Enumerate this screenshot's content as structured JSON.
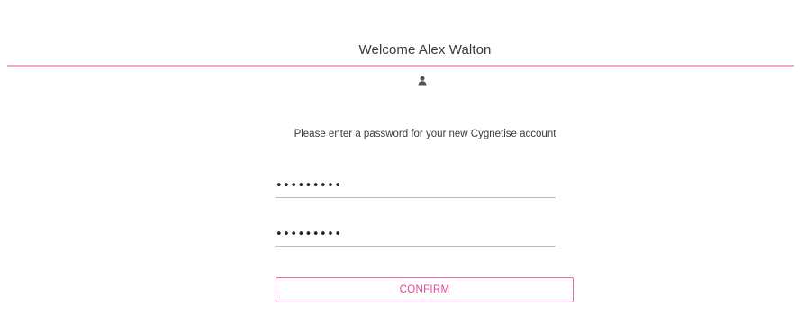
{
  "header": {
    "welcome_text": "Welcome Alex Walton",
    "accent_color": "#f2a6cf",
    "icon": "user-icon"
  },
  "form": {
    "instruction": "Please enter a password for your new Cygnetise account",
    "password_value": "•••••••••",
    "confirm_password_value": "•••••••••",
    "confirm_label": "CONFIRM",
    "button_color": "#e0489a"
  }
}
